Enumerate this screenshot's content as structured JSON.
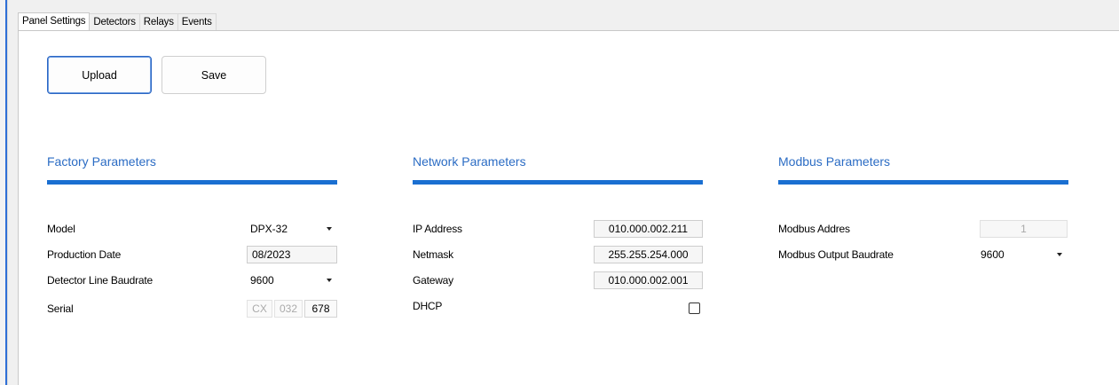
{
  "tabs": [
    {
      "label": "Panel Settings",
      "active": true
    },
    {
      "label": "Detectors",
      "active": false
    },
    {
      "label": "Relays",
      "active": false
    },
    {
      "label": "Events",
      "active": false
    }
  ],
  "toolbar": {
    "upload_label": "Upload",
    "save_label": "Save"
  },
  "factory": {
    "title": "Factory Parameters",
    "model_label": "Model",
    "model_value": "DPX-32",
    "production_date_label": "Production Date",
    "production_date_value": "08/2023",
    "baudrate_label": "Detector Line Baudrate",
    "baudrate_value": "9600",
    "serial_label": "Serial",
    "serial_parts": [
      "CX",
      "032",
      "678"
    ]
  },
  "network": {
    "title": "Network Parameters",
    "ip_label": "IP Address",
    "ip_value": "010.000.002.211",
    "netmask_label": "Netmask",
    "netmask_value": "255.255.254.000",
    "gateway_label": "Gateway",
    "gateway_value": "010.000.002.001",
    "dhcp_label": "DHCP",
    "dhcp_checked": false
  },
  "modbus": {
    "title": "Modbus Parameters",
    "address_label": "Modbus Addres",
    "address_value": "1",
    "baudrate_label": "Modbus Output Baudrate",
    "baudrate_value": "9600"
  },
  "colors": {
    "accent": "#1a6fd1",
    "section_title": "#2b6cc4"
  }
}
